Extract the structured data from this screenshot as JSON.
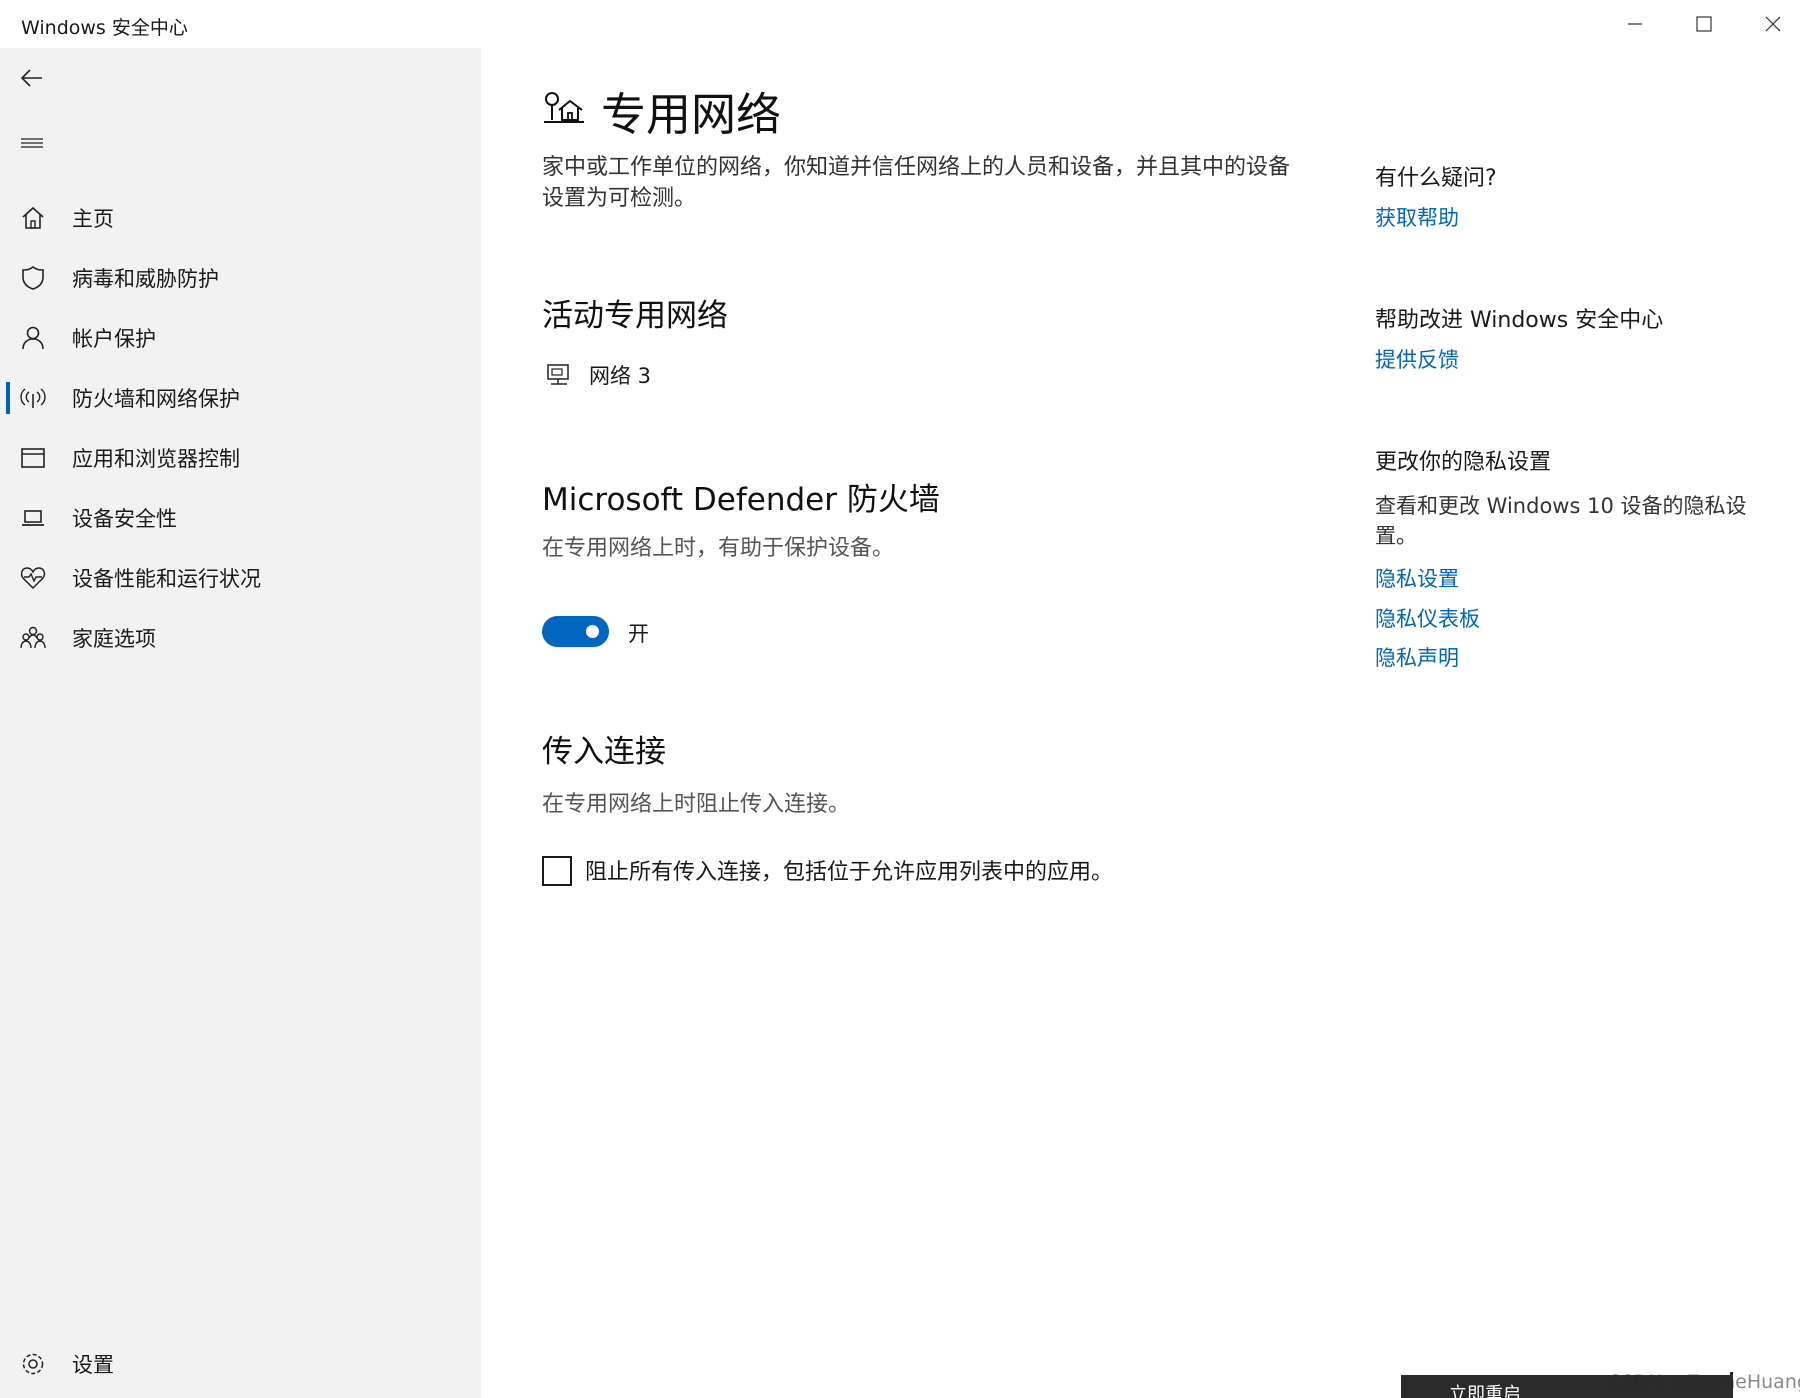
{
  "window": {
    "title": "Windows 安全中心",
    "controls": [
      "minimize-icon",
      "maximize-icon",
      "close-icon"
    ]
  },
  "sidebar": {
    "items": [
      {
        "label": "主页",
        "icon": "home-icon"
      },
      {
        "label": "病毒和威胁防护",
        "icon": "shield-icon"
      },
      {
        "label": "帐户保护",
        "icon": "person-icon"
      },
      {
        "label": "防火墙和网络保护",
        "icon": "wireless-icon",
        "active": true
      },
      {
        "label": "应用和浏览器控制",
        "icon": "browser-window-icon"
      },
      {
        "label": "设备安全性",
        "icon": "laptop-icon"
      },
      {
        "label": "设备性能和运行状况",
        "icon": "heart-pulse-icon"
      },
      {
        "label": "家庭选项",
        "icon": "family-icon"
      }
    ],
    "settings_label": "设置"
  },
  "main": {
    "title": "专用网络",
    "description": "家中或工作单位的网络，你知道并信任网络上的人员和设备，并且其中的设备设置为可检测。",
    "active_networks": {
      "heading": "活动专用网络",
      "network_name": "网络 3"
    },
    "firewall": {
      "heading": "Microsoft Defender 防火墙",
      "description": "在专用网络上时，有助于保护设备。",
      "toggle_on": true,
      "toggle_label": "开"
    },
    "incoming": {
      "heading": "传入连接",
      "description": "在专用网络上时阻止传入连接。",
      "checkbox_checked": false,
      "checkbox_label": "阻止所有传入连接，包括位于允许应用列表中的应用。"
    }
  },
  "rail": {
    "question": {
      "heading": "有什么疑问?",
      "link": "获取帮助"
    },
    "improve": {
      "heading": "帮助改进 Windows 安全中心",
      "link": "提供反馈"
    },
    "privacy": {
      "heading": "更改你的隐私设置",
      "text": "查看和更改 Windows 10 设备的隐私设置。",
      "links": [
        "隐私设置",
        "隐私仪表板",
        "隐私声明"
      ]
    }
  },
  "restart_button_label": "立即重启",
  "watermark": "CSDN @ZayneHuang",
  "colors": {
    "accent": "#0067c0",
    "link": "#0067b8",
    "sidebar_bg": "#f2f2f2"
  }
}
